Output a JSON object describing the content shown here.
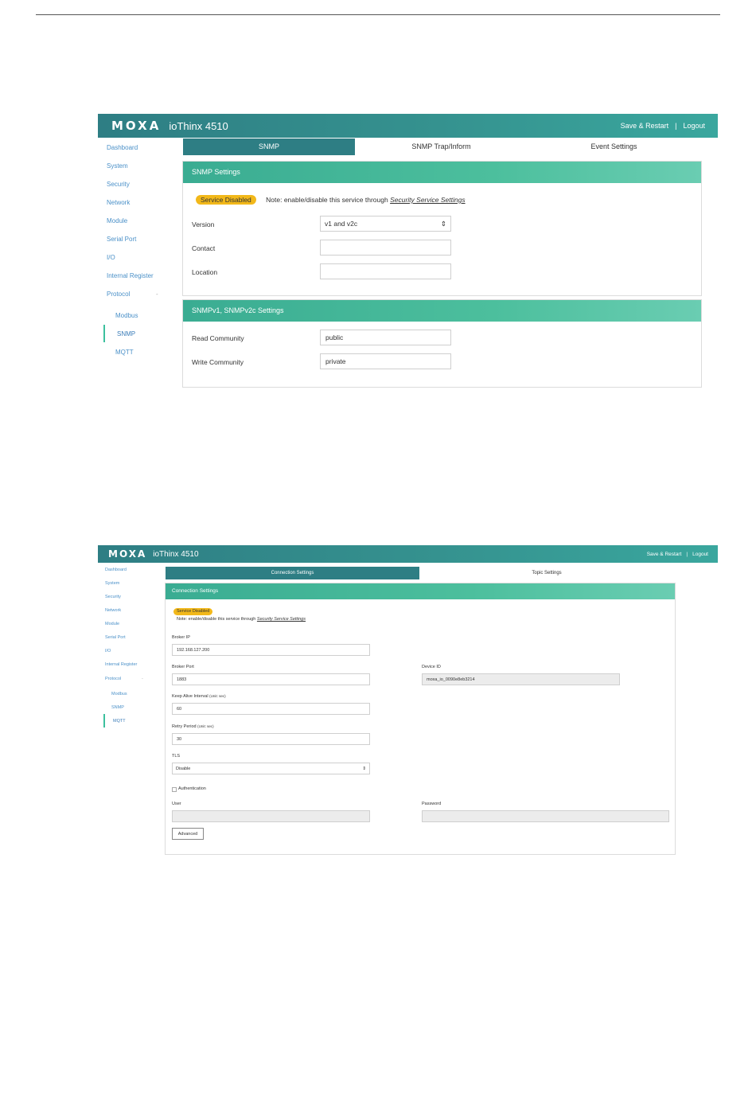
{
  "snmp_screen": {
    "header": {
      "logo": "MOXA",
      "title": "ioThinx 4510",
      "save_restart": "Save & Restart",
      "separator": "|",
      "logout": "Logout"
    },
    "sidebar": {
      "items": [
        "Dashboard",
        "System",
        "Security",
        "Network",
        "Module",
        "Serial Port",
        "I/O",
        "Internal Register",
        "Protocol"
      ],
      "protocol_chevron": "-",
      "sub_items": [
        "Modbus",
        "SNMP",
        "MQTT"
      ],
      "active": "SNMP"
    },
    "tabs": [
      "SNMP",
      "SNMP Trap/Inform",
      "Event Settings"
    ],
    "active_tab": "SNMP",
    "snmp_settings": {
      "title": "SNMP Settings",
      "badge": "Service Disabled",
      "note_prefix": "Note: enable/disable this service through ",
      "note_link": "Security Service Settings",
      "version_label": "Version",
      "version_value": "v1 and v2c",
      "contact_label": "Contact",
      "contact_value": "",
      "location_label": "Location",
      "location_value": ""
    },
    "community_settings": {
      "title": "SNMPv1, SNMPv2c Settings",
      "read_label": "Read Community",
      "read_value": "public",
      "write_label": "Write Community",
      "write_value": "private"
    }
  },
  "mqtt_screen": {
    "header": {
      "logo": "MOXA",
      "title": "ioThinx 4510",
      "save_restart": "Save & Restart",
      "separator": "|",
      "logout": "Logout"
    },
    "sidebar": {
      "items": [
        "Dashboard",
        "System",
        "Security",
        "Network",
        "Module",
        "Serial Port",
        "I/O",
        "Internal Register",
        "Protocol"
      ],
      "protocol_chevron": "-",
      "sub_items": [
        "Modbus",
        "SNMP",
        "MQTT"
      ],
      "active": "MQTT"
    },
    "tabs": [
      "Connection Settings",
      "Topic Settings"
    ],
    "active_tab": "Connection Settings",
    "connection": {
      "title": "Connection Settings",
      "badge": "Service Disabled",
      "note_prefix": "Note: enable/disable this service through ",
      "note_link": "Security Service Settings",
      "broker_ip_label": "Broker IP",
      "broker_ip_value": "192.168.127.200",
      "broker_port_label": "Broker Port",
      "broker_port_value": "1883",
      "device_id_label": "Device ID",
      "device_id_value": "moxa_io_0090e8eb3214",
      "keep_alive_label": "Keep Alive Interval",
      "keep_alive_unit": "(Unit: sec)",
      "keep_alive_value": "60",
      "retry_label": "Retry Period",
      "retry_unit": "(Unit: sec)",
      "retry_value": "30",
      "tls_label": "TLS",
      "tls_value": "Disable",
      "auth_label": "Authentication",
      "auth_checked": false,
      "user_label": "User",
      "user_value": "",
      "password_label": "Password",
      "password_value": "",
      "advanced_button": "Advanced"
    }
  }
}
